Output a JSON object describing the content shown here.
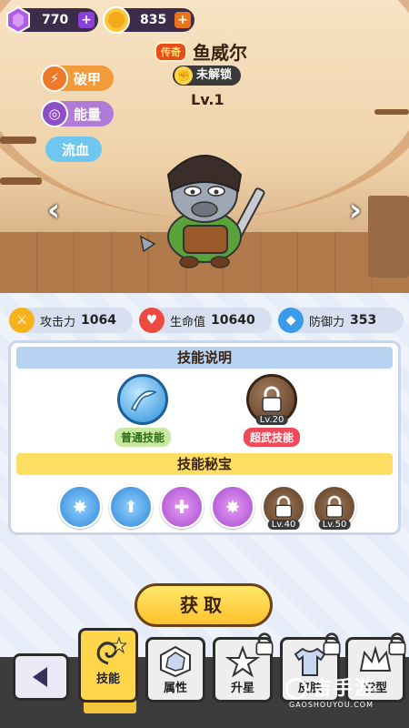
{
  "resources": {
    "gems": {
      "value": "770",
      "icon": "purple-gem-icon"
    },
    "coins": {
      "value": "835",
      "icon": "gold-coin-icon"
    }
  },
  "hero": {
    "rarity": "传奇",
    "name": "鱼威尔",
    "status": "未解锁",
    "level": "Lv.1"
  },
  "traits": [
    {
      "label": "破甲",
      "color": "#f39a3a"
    },
    {
      "label": "能量",
      "color": "#b07ad8"
    },
    {
      "label": "流血",
      "color": "#6fc7ef"
    }
  ],
  "stats": [
    {
      "label": "攻击力",
      "value": "1064",
      "icon": "sword-icon",
      "color": "#f6b21a"
    },
    {
      "label": "生命值",
      "value": "10640",
      "icon": "heart-icon",
      "color": "#ef4a3f"
    },
    {
      "label": "防御力",
      "value": "353",
      "icon": "shield-icon",
      "color": "#3a9be8"
    }
  ],
  "skills": {
    "title": "技能说明",
    "items": [
      {
        "label": "普通技能",
        "icon": "slash-skill-icon"
      },
      {
        "label": "超武技能",
        "icon": "locked-skill-icon",
        "level": "Lv.20"
      }
    ]
  },
  "treasure": {
    "title": "技能秘宝",
    "items": [
      {
        "icon": "burst-buff-icon",
        "level": ""
      },
      {
        "icon": "shield-up-icon",
        "level": ""
      },
      {
        "icon": "potion-plus-icon",
        "level": ""
      },
      {
        "icon": "burst-purple-icon",
        "level": ""
      },
      {
        "icon": "locked-treasure-icon",
        "level": "Lv.40"
      },
      {
        "icon": "locked-treasure-icon",
        "level": "Lv.50"
      }
    ]
  },
  "get_button": "获取",
  "nav": {
    "tabs": [
      {
        "label": "技能",
        "active": true
      },
      {
        "label": "属性",
        "active": false
      },
      {
        "label": "升星",
        "active": false
      },
      {
        "label": "皮肤",
        "active": false
      },
      {
        "label": "堂型",
        "active": false
      }
    ]
  },
  "watermark": {
    "main": "吉手游",
    "sub": "GAOSHOUYOU.COM"
  }
}
